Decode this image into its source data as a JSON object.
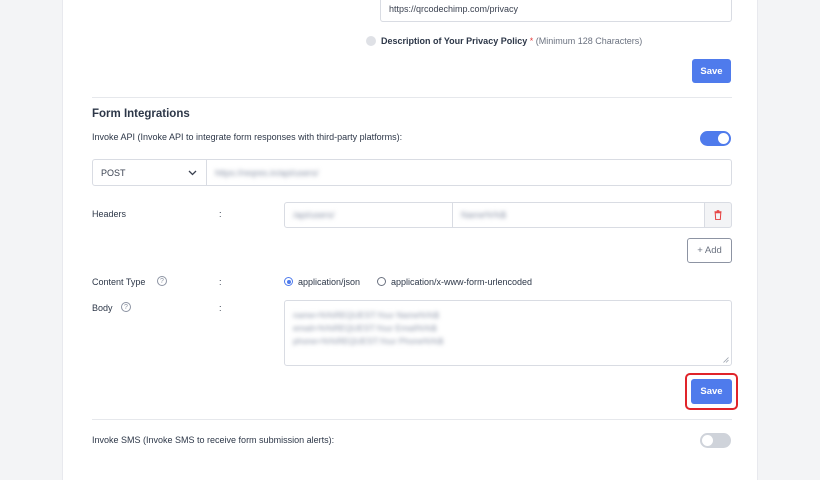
{
  "privacy": {
    "url_value": "https://qrcodechimp.com/privacy",
    "description_label": "Description of Your Privacy Policy",
    "required_mark": "*",
    "description_hint": "(Minimum 128 Characters)",
    "save_label": "Save"
  },
  "form_integrations": {
    "title": "Form Integrations",
    "invoke_api_label": "Invoke API (Invoke API to integrate form responses with third-party platforms):",
    "invoke_api_enabled": true,
    "method": "POST",
    "api_url": "https://reqres.in/api/users/",
    "headers_label": "Headers",
    "colon": ":",
    "header_key": "/api/users/",
    "header_value": "Name%%$",
    "add_label": "+ Add",
    "content_type_label": "Content Type",
    "content_type_options": [
      "application/json",
      "application/x-www-form-urlencoded"
    ],
    "content_type_selected": "application/json",
    "body_label": "Body",
    "body_lines": [
      "name=%%REQUEST:Your Name%%$",
      "email=%%REQUEST:Your Email%%$",
      "phone=%%REQUEST:Your Phone%%$"
    ],
    "save_label": "Save",
    "invoke_sms_label": "Invoke SMS (Invoke SMS to receive form submission alerts):",
    "invoke_sms_enabled": false
  },
  "colors": {
    "accent": "#4f7bec",
    "highlight_border": "#e0242a",
    "delete_icon": "#e53e3e",
    "toggle_off": "#cfd3da"
  },
  "icons": {
    "help": "help-circle-icon",
    "delete": "trash-icon",
    "dropdown": "chevron-down-icon"
  }
}
